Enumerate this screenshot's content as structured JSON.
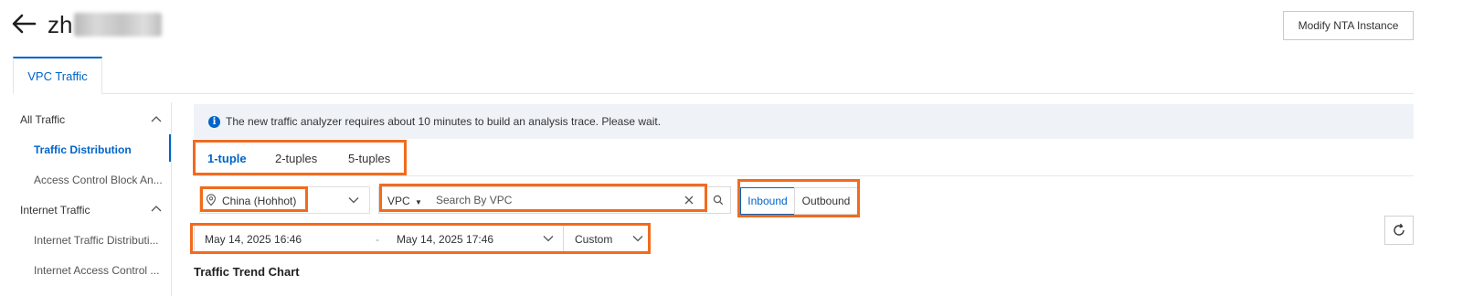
{
  "header": {
    "title_visible": "zh",
    "modify_button": "Modify NTA Instance"
  },
  "tabs": [
    {
      "label": "VPC Traffic",
      "active": true
    }
  ],
  "sidebar": {
    "groups": [
      {
        "label": "All Traffic",
        "items": [
          {
            "label": "Traffic Distribution",
            "active": true
          },
          {
            "label": "Access Control Block An..."
          }
        ]
      },
      {
        "label": "Internet Traffic",
        "items": [
          {
            "label": "Internet Traffic Distributi..."
          },
          {
            "label": "Internet Access Control ..."
          }
        ]
      }
    ]
  },
  "notice": {
    "icon": "info-icon",
    "text": "The new traffic analyzer requires about 10 minutes to build an analysis trace. Please wait."
  },
  "subtabs": [
    {
      "label": "1-tuple",
      "active": true
    },
    {
      "label": "2-tuples"
    },
    {
      "label": "5-tuples"
    }
  ],
  "filters": {
    "region": "China (Hohhot)",
    "search_type": "VPC",
    "search_placeholder": "Search By VPC",
    "direction": {
      "inbound": "Inbound",
      "outbound": "Outbound",
      "selected": "Inbound"
    },
    "date_start": "May 14, 2025 16:46",
    "date_separator": "-",
    "date_end": "May 14, 2025 17:46",
    "range_mode": "Custom"
  },
  "section_title": "Traffic Trend Chart",
  "colors": {
    "accent": "#0064c8",
    "highlight": "#f26b1d",
    "notice_bg": "#eff3f8"
  }
}
